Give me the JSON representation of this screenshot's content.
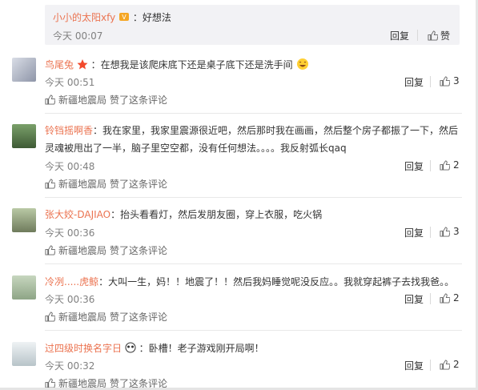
{
  "top_reply": {
    "user": "小小的太阳xfy",
    "text": "：好想法",
    "time": "今天 00:07",
    "reply": "回复",
    "like": "赞"
  },
  "comments": [
    {
      "user": "鸟尾兔",
      "text": "：在想我是该爬床底下还是桌子底下还是洗手间",
      "time": "今天 00:51",
      "reply": "回复",
      "likes": "3",
      "liked_by": "新疆地震局",
      "liked_action": "赞了这条评论"
    },
    {
      "user": "铃铛摇啊香",
      "text": "：我在家里，我家里震源很近吧，然后那时我在画画，然后整个房子都振了一下，然后灵魂被甩出了一半，脑子里空空都，没有任何想法。。。。我反射弧长qaq",
      "time": "今天 00:48",
      "reply": "回复",
      "likes": "2",
      "liked_by": "新疆地震局",
      "liked_action": "赞了这条评论"
    },
    {
      "user": "张大姣-DAJIAO",
      "text": "：抬头看看灯，然后发朋友圈，穿上衣服，吃火锅",
      "time": "今天 00:36",
      "reply": "回复",
      "likes": "3",
      "liked_by": "新疆地震局",
      "liked_action": "赞了这条评论"
    },
    {
      "user": "冷冽.....虎鲸",
      "text": "：大叫一生，妈！！地震了！！然后我妈睡觉呢没反应。。我就穿起裤子去找我爸。。",
      "time": "今天 00:36",
      "reply": "回复",
      "likes": "2",
      "liked_by": "新疆地震局",
      "liked_action": "赞了这条评论"
    },
    {
      "user": "过四级时换名字日",
      "text": "：卧槽！老子游戏刚开局啊！",
      "time": "今天 00:32",
      "reply": "回复",
      "likes": "2",
      "liked_by": "新疆地震局",
      "liked_action": "赞了这条评论"
    }
  ],
  "colors": {
    "username": "#eb7350",
    "meta_gray": "#808080"
  }
}
